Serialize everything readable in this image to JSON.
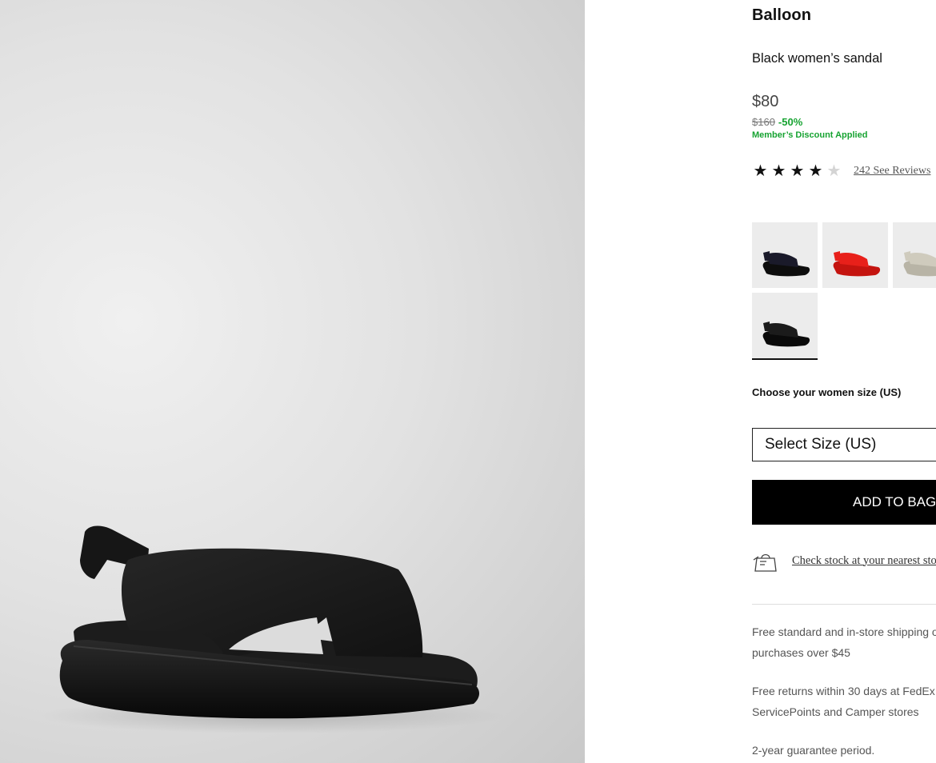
{
  "product": {
    "name": "Balloon",
    "description": "Black women’s sandal",
    "price": "$80",
    "original_price": "$160",
    "discount": "-50%",
    "member_discount": "Member’s Discount Applied"
  },
  "rating": {
    "stars": 4,
    "max_stars": 5,
    "reviews_link": "242 See Reviews"
  },
  "variants": [
    {
      "color": "black",
      "selected": false
    },
    {
      "color": "red",
      "selected": false
    },
    {
      "color": "beige",
      "selected": false
    },
    {
      "color": "black",
      "selected": true
    }
  ],
  "size": {
    "label": "Choose your women size (US)",
    "select_placeholder": "Select Size (US)"
  },
  "actions": {
    "add_to_bag": "ADD TO BAG",
    "check_stock": "Check stock at your nearest store"
  },
  "shipping": {
    "line1a": "Free standard and in-store shipping on",
    "line1b": "purchases over $45",
    "line2a": "Free returns within 30 days at FedEx",
    "line2b": "ServicePoints and Camper stores",
    "line3": "2-year guarantee period."
  },
  "colors": {
    "discount_green": "#16a331",
    "button_black": "#000000",
    "red_variant": "#e8201a",
    "beige_variant": "#cfcbbd"
  }
}
